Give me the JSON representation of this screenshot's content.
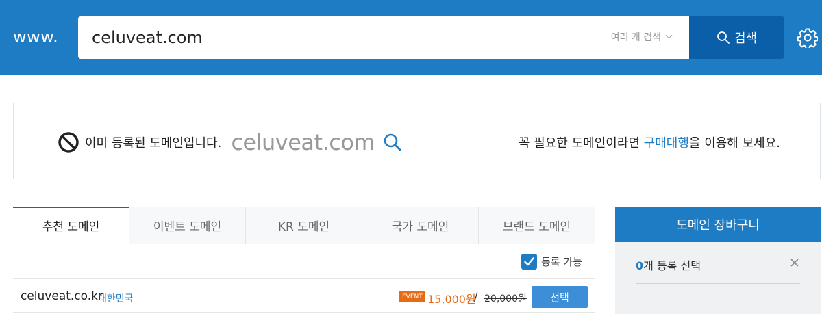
{
  "header": {
    "prefix": "www.",
    "search_value": "celuveat.com",
    "multi_search_label": "여러 개 검색",
    "search_button_label": "검색",
    "bg_color": "#1e7cc4",
    "button_color": "#0b5ea8"
  },
  "notice": {
    "message": "이미 등록된 도메인입니다.",
    "domain": "celuveat.com",
    "right_prefix": "꼭 필요한 도메인이라면 ",
    "right_link": "구매대행",
    "right_suffix": "을 이용해 보세요."
  },
  "tabs": [
    {
      "label": "추천 도메인",
      "active": true
    },
    {
      "label": "이벤트 도메인",
      "active": false
    },
    {
      "label": "KR 도메인",
      "active": false
    },
    {
      "label": "국가 도메인",
      "active": false
    },
    {
      "label": "브랜드 도메인",
      "active": false
    }
  ],
  "filter": {
    "label": "등록 가능",
    "checked": true
  },
  "results": [
    {
      "domain": "celuveat.co.kr",
      "country": "대한민국",
      "badge": "EVENT",
      "price": "15,000원",
      "separator": "/",
      "original_price": "20,000원",
      "button_label": "선택"
    }
  ],
  "cart": {
    "title": "도메인 장바구니",
    "count": "0",
    "count_suffix": "개 등록 선택"
  },
  "colors": {
    "accent": "#1e7cc4",
    "event": "#e86a12"
  },
  "icons": {
    "search": "magnifier-icon",
    "settings": "gear-icon",
    "ban": "ban-icon",
    "close": "close-icon",
    "dropdown": "chevron-down-icon",
    "check": "checkmark-icon"
  }
}
